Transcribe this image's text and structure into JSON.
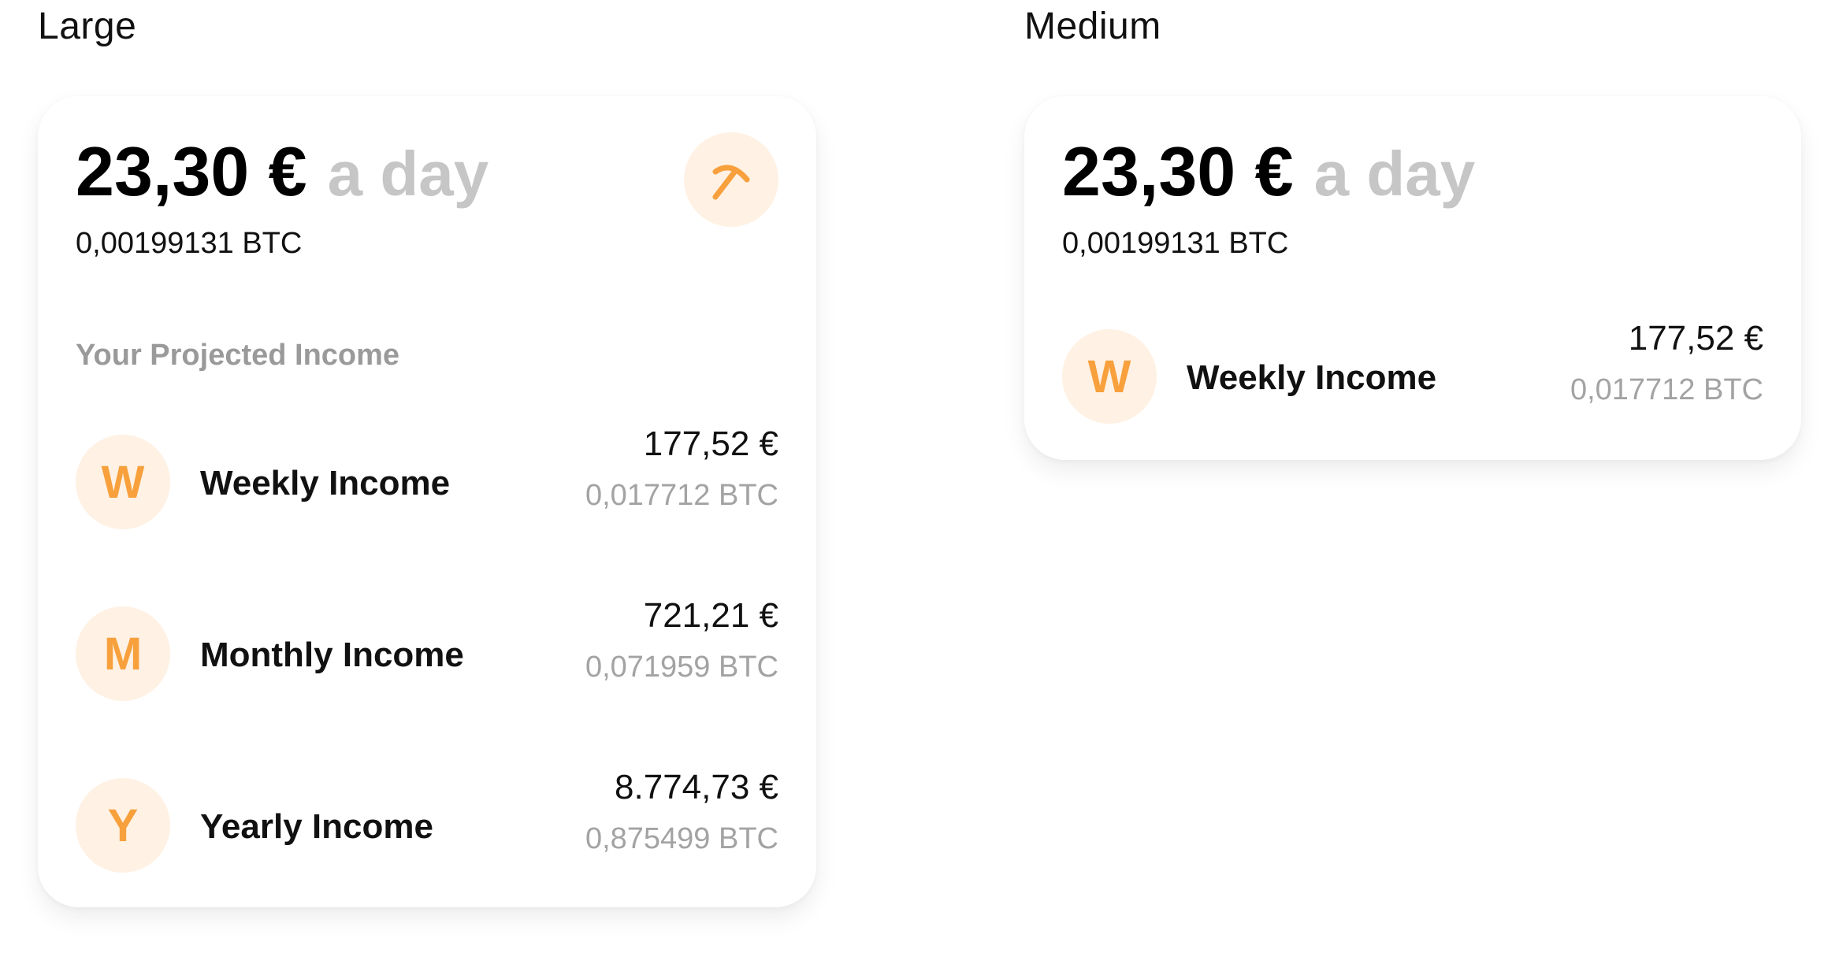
{
  "labels": {
    "large": "Large",
    "medium": "Medium"
  },
  "widget": {
    "daily_amount": "23,30 €",
    "daily_suffix": "a day",
    "daily_btc": "0,00199131 BTC",
    "action_icon": "pickaxe-icon",
    "section_title": "Your Projected Income",
    "accent_color": "#f7a03c",
    "badge_bg_color": "#fff1e3",
    "rows": [
      {
        "badge": "W",
        "label": "Weekly Income",
        "eur": "177,52 €",
        "btc": "0,017712 BTC"
      },
      {
        "badge": "M",
        "label": "Monthly Income",
        "eur": "721,21 €",
        "btc": "0,071959 BTC"
      },
      {
        "badge": "Y",
        "label": "Yearly Income",
        "eur": "8.774,73 €",
        "btc": "0,875499 BTC"
      }
    ]
  },
  "medium_widget": {
    "daily_amount": "23,30 €",
    "daily_suffix": "a day",
    "daily_btc": "0,00199131 BTC",
    "row": {
      "badge": "W",
      "label": "Weekly Income",
      "eur": "177,52 €",
      "btc": "0,017712 BTC"
    }
  }
}
